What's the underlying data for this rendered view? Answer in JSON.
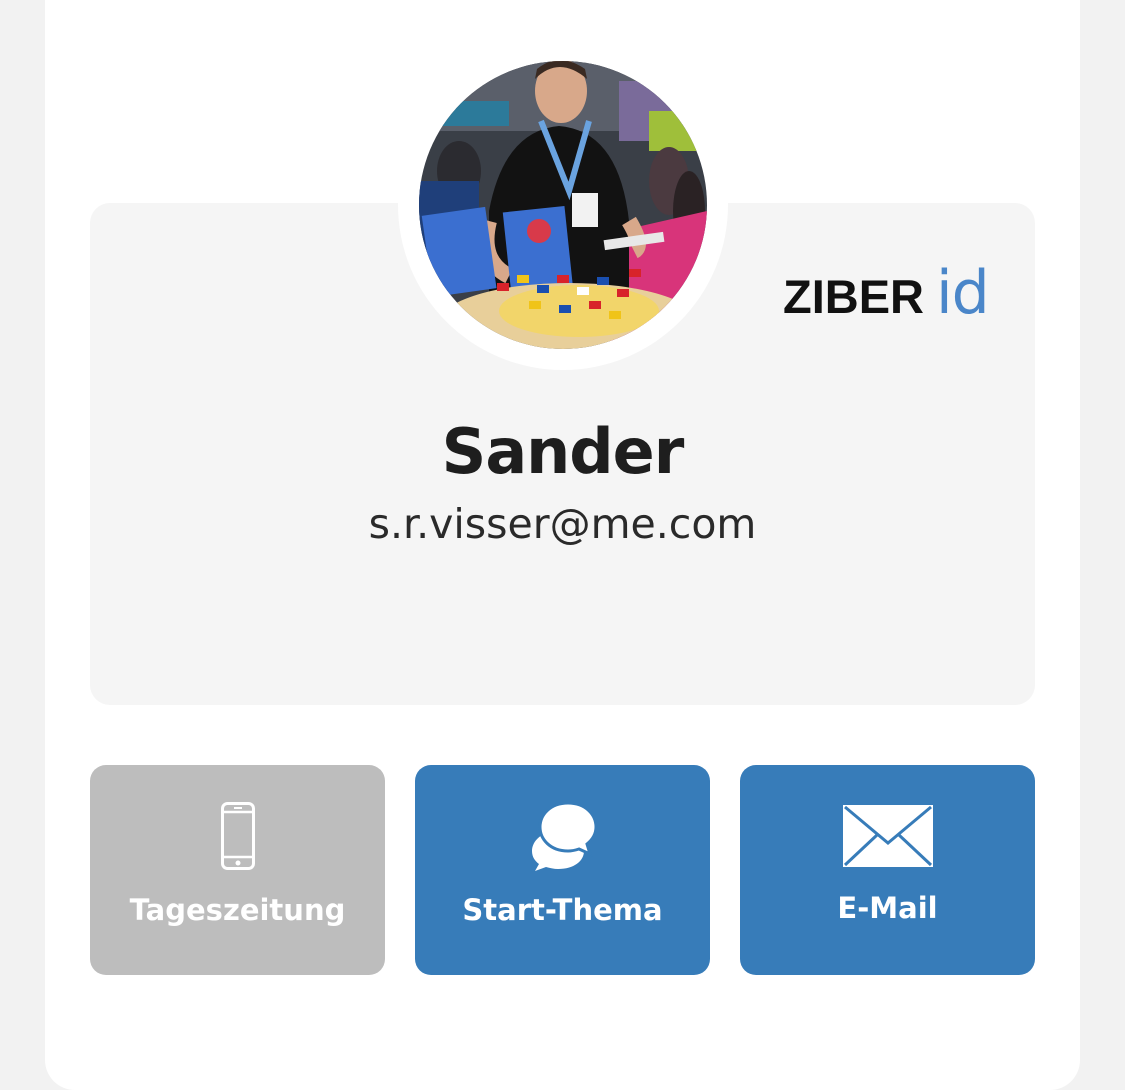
{
  "profile": {
    "name": "Sander",
    "email": "s.r.visser@me.com"
  },
  "brand": {
    "main": "ZIBER",
    "suffix": "id",
    "suffix_color": "#4a86c9"
  },
  "actions": [
    {
      "label": "Tageszeitung",
      "icon": "phone-icon",
      "color": "#bdbdbd",
      "state": "disabled"
    },
    {
      "label": "Start-Thema",
      "icon": "chat-bubbles-icon",
      "color": "#377cb9",
      "state": "enabled"
    },
    {
      "label": "E-Mail",
      "icon": "envelope-icon",
      "color": "#377cb9",
      "state": "enabled"
    }
  ],
  "colors": {
    "background": "#f2f2f2",
    "card": "#ffffff",
    "panel": "#f5f5f5",
    "accent": "#377cb9",
    "disabled": "#bdbdbd"
  }
}
